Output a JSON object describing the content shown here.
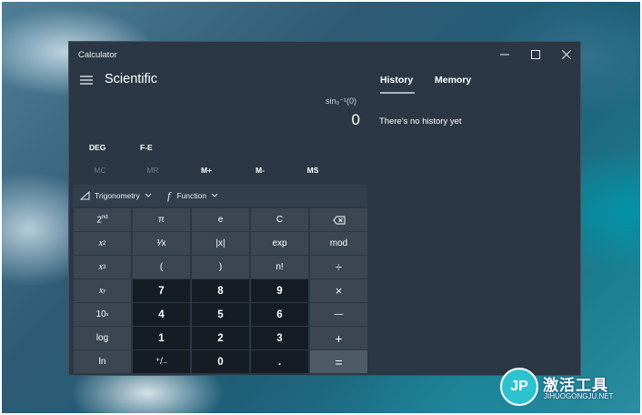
{
  "window": {
    "title": "Calculator"
  },
  "header": {
    "mode": "Scientific"
  },
  "display": {
    "expression": "sin₀⁻¹(0)",
    "value": "0"
  },
  "angle": {
    "unit": "DEG",
    "notation": "F-E"
  },
  "memory": {
    "mc": "MC",
    "mr": "MR",
    "mplus": "M+",
    "mminus": "M-",
    "ms": "MS"
  },
  "functions": {
    "trig": "Trigonometry",
    "func": "Function"
  },
  "keys": {
    "second": "2nd",
    "pi": "π",
    "e": "e",
    "clear": "C",
    "x_squared_base": "x",
    "x_squared_exp": "2",
    "reciprocal": "¹⁄x",
    "abs": "|x|",
    "exp": "exp",
    "mod": "mod",
    "x_cubed_base": "x",
    "x_cubed_exp": "3",
    "lparen": "(",
    "rparen": ")",
    "factorial": "n!",
    "divide": "÷",
    "x_pow_y_base": "x",
    "x_pow_y_exp": "y",
    "seven": "7",
    "eight": "8",
    "nine": "9",
    "multiply": "×",
    "ten_pow_base": "10",
    "ten_pow_exp": "x",
    "four": "4",
    "five": "5",
    "six": "6",
    "minus": "—",
    "log": "log",
    "one": "1",
    "two": "2",
    "three": "3",
    "plus": "+",
    "ln": "ln",
    "negate": "⁺/₋",
    "zero": "0",
    "decimal": ".",
    "equals": "="
  },
  "history_panel": {
    "tabs": [
      "History",
      "Memory"
    ],
    "active_tab": "History",
    "empty_message": "There's no history yet"
  },
  "watermark": {
    "brand": "激活工具",
    "site": "JIHUOGONGJU.NET",
    "logo_letters": "JP"
  },
  "colors": {
    "window_bg": "#2b3744",
    "number_key": "#161c24",
    "function_key": "#3b4652",
    "accent": "#aab4be"
  }
}
